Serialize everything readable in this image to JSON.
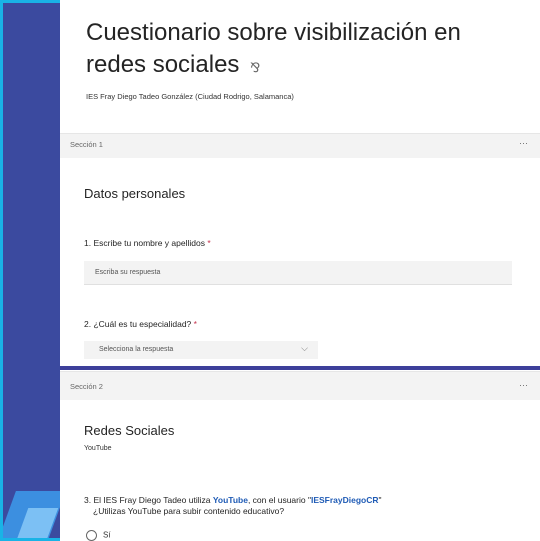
{
  "form": {
    "title": "Cuestionario sobre visibilización en redes sociales",
    "organization": "IES Fray Diego Tadeo González (Ciudad Rodrigo, Salamanca)"
  },
  "sections": [
    {
      "label": "Sección 1",
      "more": "···",
      "title": "Datos personales",
      "questions": [
        {
          "number": "1.",
          "text": "Escribe tu nombre y apellidos",
          "required": "*",
          "placeholder": "Escriba su respuesta"
        },
        {
          "number": "2.",
          "text": "¿Cuál es tu especialidad?",
          "required": "*",
          "select_value": "Selecciona la respuesta"
        }
      ]
    },
    {
      "label": "Sección 2",
      "more": "···",
      "title": "Redes Sociales",
      "subtitle": "YouTube",
      "question": {
        "number": "3.",
        "text_before": "El IES Fray Diego Tadeo utiliza ",
        "highlight1": "YouTube",
        "text_middle": ", con el usuario \"",
        "highlight2": "IESFrayDiegoCR",
        "text_after": "\"",
        "line2": "¿Utilizas YouTube para subir contenido educativo?"
      },
      "option_first": "Sí"
    }
  ]
}
